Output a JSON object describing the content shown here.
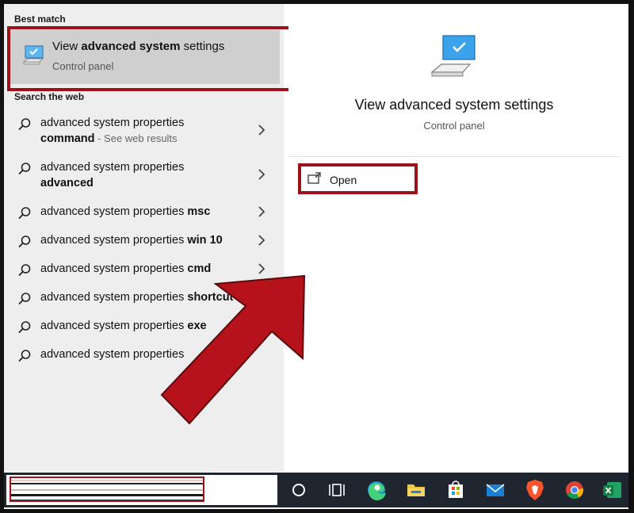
{
  "left_panel": {
    "best_match_heading": "Best match",
    "best_match": {
      "title_prefix": "View ",
      "title_bold": "advanced system",
      "title_suffix": " settings",
      "subtitle": "Control panel"
    },
    "search_web_heading": "Search the web",
    "web_results": [
      {
        "line1": "advanced system properties",
        "line2_bold": "command",
        "line2_hint": " - See web results"
      },
      {
        "line1": "advanced system properties",
        "line2_bold": "advanced"
      },
      {
        "prefix": "advanced system properties ",
        "bold": "msc"
      },
      {
        "prefix": "advanced system properties ",
        "bold": "win 10"
      },
      {
        "prefix": "advanced system properties ",
        "bold": "cmd"
      },
      {
        "prefix": "advanced system properties ",
        "bold": "shortcut"
      },
      {
        "prefix": "advanced system properties ",
        "bold": "exe"
      },
      {
        "prefix": "advanced system properties",
        "bold": ""
      }
    ]
  },
  "right_panel": {
    "title": "View advanced system settings",
    "subtitle": "Control panel",
    "open_label": "Open"
  },
  "taskbar": {
    "icons": [
      "cortana-icon",
      "task-view-icon",
      "edge-icon",
      "file-explorer-icon",
      "store-icon",
      "mail-icon",
      "brave-icon",
      "chrome-icon",
      "excel-icon"
    ]
  },
  "colors": {
    "highlight_red": "#9b1218",
    "taskbar_bg": "#1f2630",
    "selected_bg": "#cfcfcf",
    "panel_bg": "#eeeeee"
  }
}
